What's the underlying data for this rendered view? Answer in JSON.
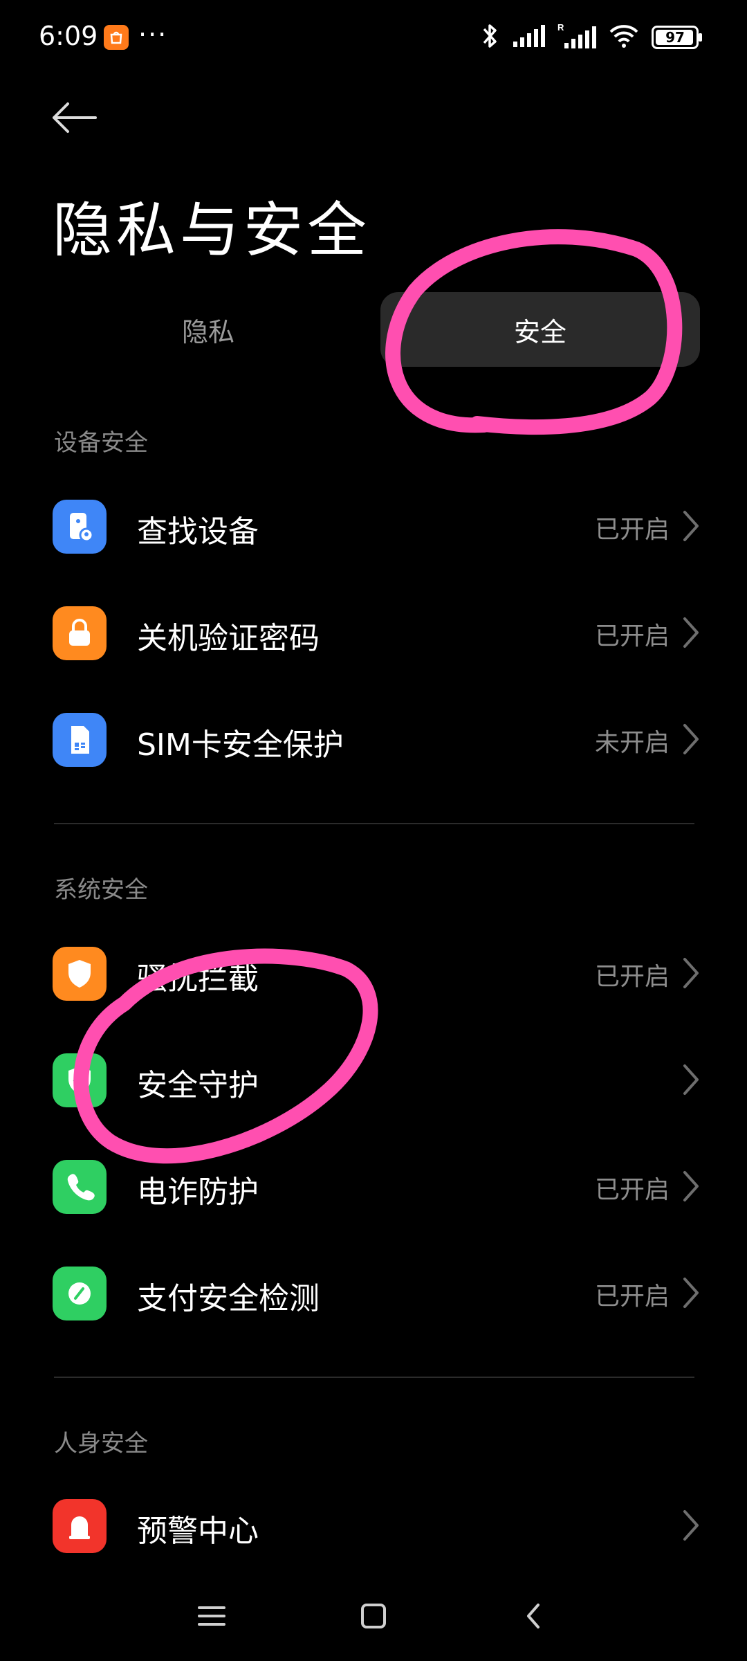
{
  "status_bar": {
    "time": "6:09",
    "app_badge_icon": "shopping-bag-icon",
    "more": "···",
    "icons": [
      "bluetooth-icon",
      "signal-icon",
      "roaming-signal-icon",
      "wifi-icon"
    ],
    "battery": "97",
    "battery_level": 0.97
  },
  "header": {
    "back_icon": "back-arrow-icon",
    "title": "隐私与安全"
  },
  "tabs": [
    {
      "label": "隐私",
      "selected": false
    },
    {
      "label": "安全",
      "selected": true
    }
  ],
  "sections": [
    {
      "title": "设备安全",
      "items": [
        {
          "label": "查找设备",
          "status": "已开启",
          "icon": "find-device-icon",
          "color": "#3f86f7"
        },
        {
          "label": "关机验证密码",
          "status": "已开启",
          "icon": "lock-icon",
          "color": "#ff8a1f"
        },
        {
          "label": "SIM卡安全保护",
          "status": "未开启",
          "icon": "sim-card-icon",
          "color": "#3f86f7"
        }
      ]
    },
    {
      "title": "系统安全",
      "items": [
        {
          "label": "骚扰拦截",
          "status": "已开启",
          "icon": "shield-icon",
          "color": "#ff8a1f"
        },
        {
          "label": "安全守护",
          "status": "",
          "icon": "shield-check-icon",
          "color": "#2fcf62"
        },
        {
          "label": "电诈防护",
          "status": "已开启",
          "icon": "phone-icon",
          "color": "#2fcf62"
        },
        {
          "label": "支付安全检测",
          "status": "已开启",
          "icon": "payment-check-icon",
          "color": "#2fcf62"
        }
      ]
    },
    {
      "title": "人身安全",
      "items": [
        {
          "label": "预警中心",
          "status": "",
          "icon": "alarm-icon",
          "color": "#f2342b"
        }
      ]
    }
  ],
  "nav": [
    "menu-icon",
    "home-icon",
    "back-icon"
  ],
  "colors": {
    "background": "#000000",
    "annotation": "#ff4fb0",
    "tab_selected_bg": "#2a2a2a"
  }
}
